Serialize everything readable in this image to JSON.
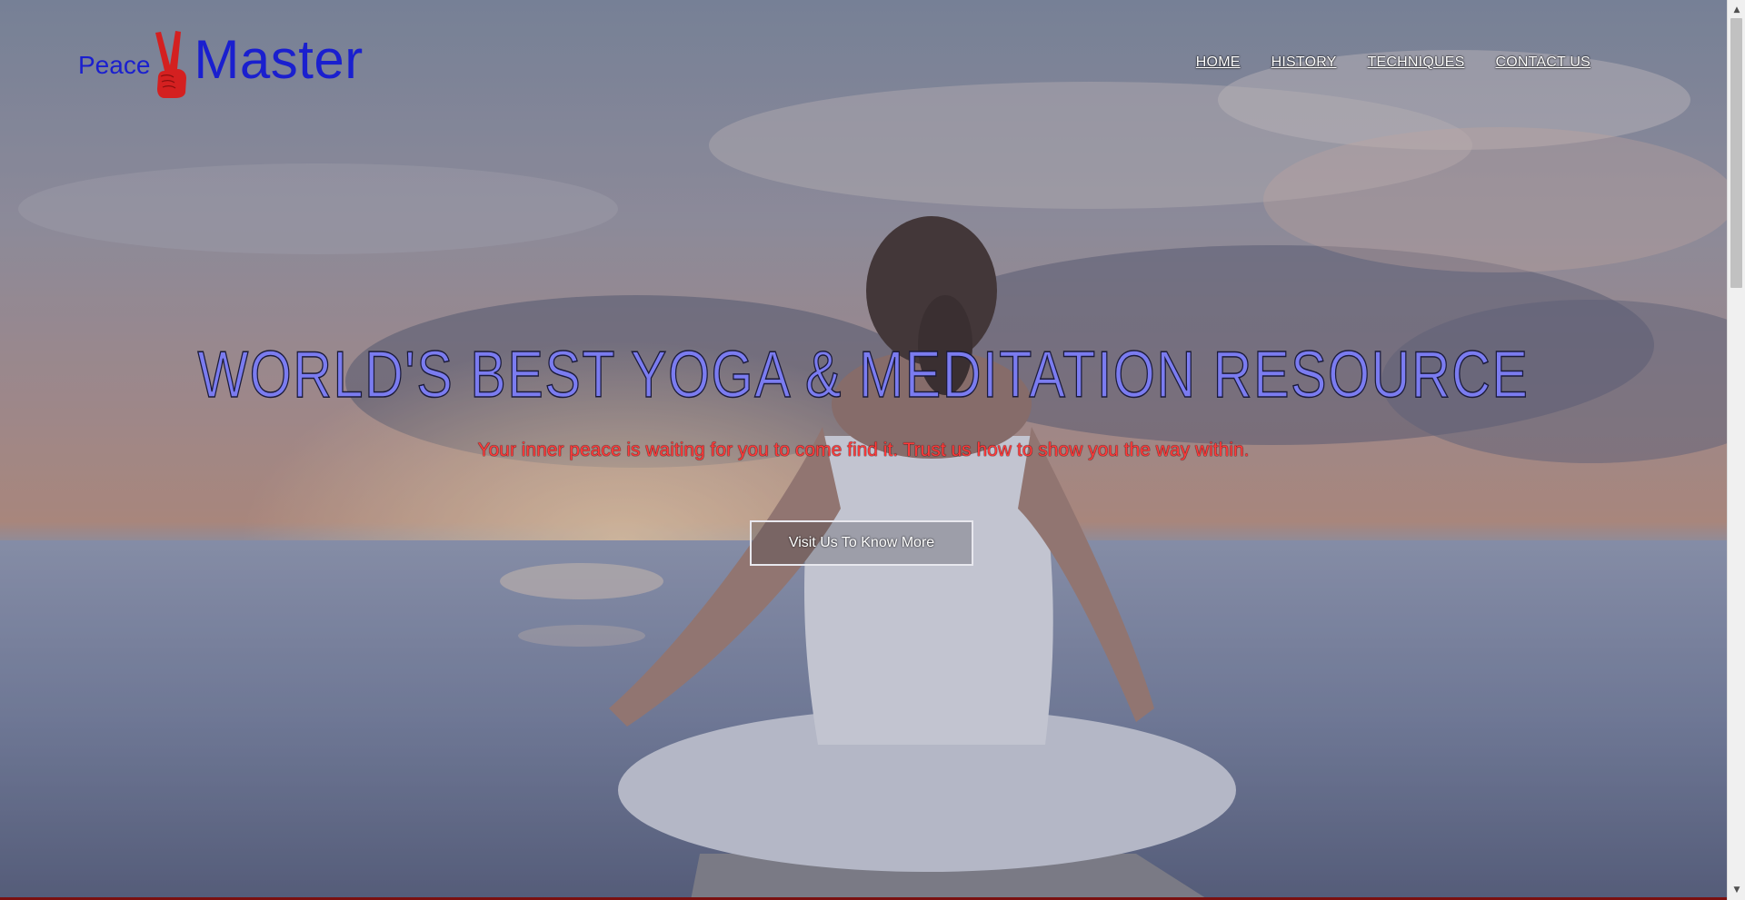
{
  "logo": {
    "word1": "Peace",
    "word2": "Master",
    "icon": "peace-hand-icon",
    "text_color": "#1a1fcf",
    "hand_color": "#d42020"
  },
  "nav": {
    "items": [
      {
        "label": "HOME"
      },
      {
        "label": "HISTORY"
      },
      {
        "label": "TECHNIQUES"
      },
      {
        "label": "CONTACT US"
      }
    ]
  },
  "hero": {
    "title": "WORLD'S BEST YOGA & MEDITATION RESOURCE",
    "subtitle": "Your inner peace is waiting for you to come find it. Trust us how to show you the way within.",
    "cta_label": "Visit Us To Know More",
    "title_color": "#7b7cf0",
    "subtitle_color": "#ff3b3b"
  },
  "scrollbar": {
    "up_icon": "scroll-up-arrow-icon",
    "down_icon": "scroll-down-arrow-icon"
  }
}
